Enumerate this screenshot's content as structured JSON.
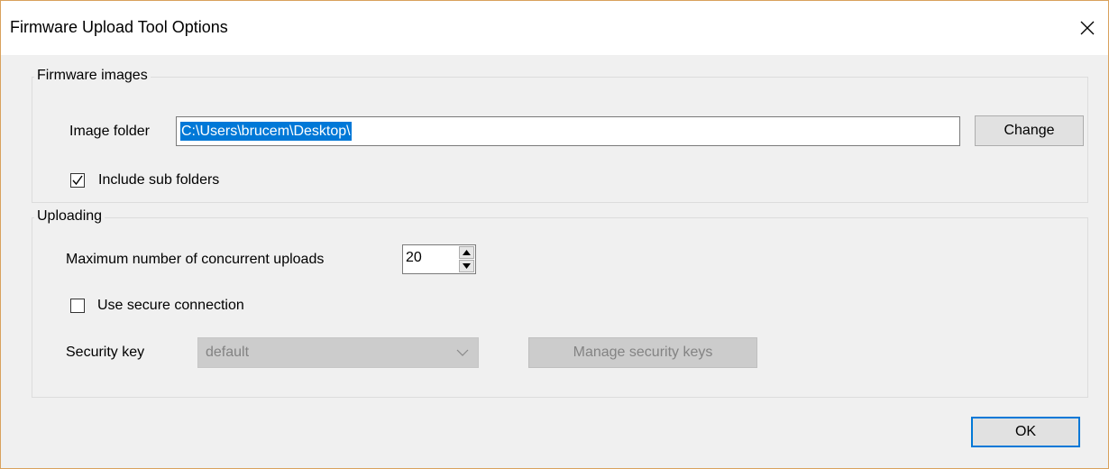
{
  "window": {
    "title": "Firmware Upload Tool Options"
  },
  "firmware_images": {
    "legend": "Firmware images",
    "image_folder_label": "Image folder",
    "image_folder_value": "C:\\Users\\brucem\\Desktop\\",
    "change_label": "Change",
    "include_sub_folders_label": "Include sub folders",
    "include_sub_folders_checked": true
  },
  "uploading": {
    "legend": "Uploading",
    "max_uploads_label": "Maximum number of concurrent uploads",
    "max_uploads_value": "20",
    "secure_connection_label": "Use secure connection",
    "secure_connection_checked": false,
    "security_key_label": "Security key",
    "security_key_value": "default",
    "manage_keys_label": "Manage security keys"
  },
  "footer": {
    "ok_label": "OK"
  },
  "icons": {
    "close": "close-icon",
    "check": "checkmark-icon",
    "spin_up": "arrow-up-icon",
    "spin_down": "arrow-down-icon",
    "dropdown": "chevron-down-icon"
  },
  "colors": {
    "accent": "#0078d7",
    "window_border": "#d9a15d",
    "dialog_bg": "#f0f0f0"
  }
}
